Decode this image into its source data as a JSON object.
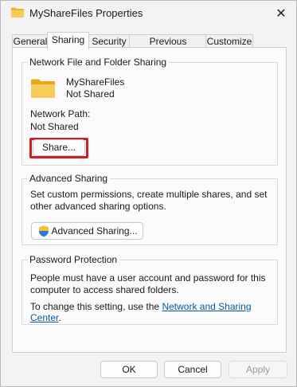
{
  "window": {
    "title": "MyShareFiles Properties"
  },
  "tabs": [
    {
      "label": "General"
    },
    {
      "label": "Sharing"
    },
    {
      "label": "Security"
    },
    {
      "label": "Previous Versions"
    },
    {
      "label": "Customize"
    }
  ],
  "network_sharing": {
    "group_title": "Network File and Folder Sharing",
    "folder_name": "MyShareFiles",
    "share_status": "Not Shared",
    "network_path_label": "Network Path:",
    "network_path_value": "Not Shared",
    "share_button": "Share..."
  },
  "advanced_sharing": {
    "group_title": "Advanced Sharing",
    "description": "Set custom permissions, create multiple shares, and set other advanced sharing options.",
    "button": "Advanced Sharing..."
  },
  "password_protection": {
    "group_title": "Password Protection",
    "description": "People must have a user account and password for this computer to access shared folders.",
    "change_prefix": "To change this setting, use the ",
    "link": "Network and Sharing Center",
    "change_suffix": "."
  },
  "footer": {
    "ok": "OK",
    "cancel": "Cancel",
    "apply": "Apply"
  },
  "colors": {
    "highlight": "#cc1f2b",
    "link": "#0a57a8",
    "folder": "#f5c542"
  },
  "icons": {
    "title_icon": "folder-icon",
    "folder_icon": "folder-icon",
    "shield_icon": "uac-shield-icon",
    "close_icon": "close-icon"
  }
}
